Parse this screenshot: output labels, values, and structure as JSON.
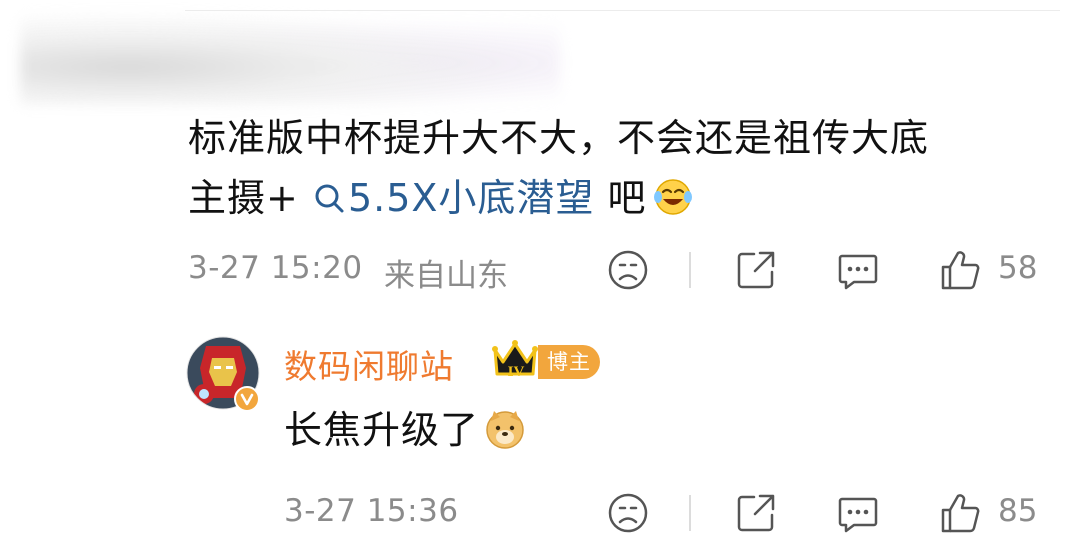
{
  "comment": {
    "line1": "标准版中杯提升大不大，不会还是祖传大底",
    "line2_prefix": "主摄+",
    "topic_link": "5.5X小底潜望",
    "line2_suffix": " 吧",
    "emoji": "laugh-cry-emoji",
    "timestamp": "3-27 15:20",
    "location": "来自山东",
    "like_count": "58"
  },
  "reply": {
    "username": "数码闲聊站",
    "level_badge": "IV",
    "role_badge": "博主",
    "text": "长焦升级了",
    "emoji": "doge-emoji",
    "timestamp": "3-27 15:36",
    "like_count": "85"
  },
  "colors": {
    "link": "#2a5d92",
    "username": "#ef7a2f",
    "badge": "#f2a63d",
    "meta_text": "#8b8b8b"
  }
}
